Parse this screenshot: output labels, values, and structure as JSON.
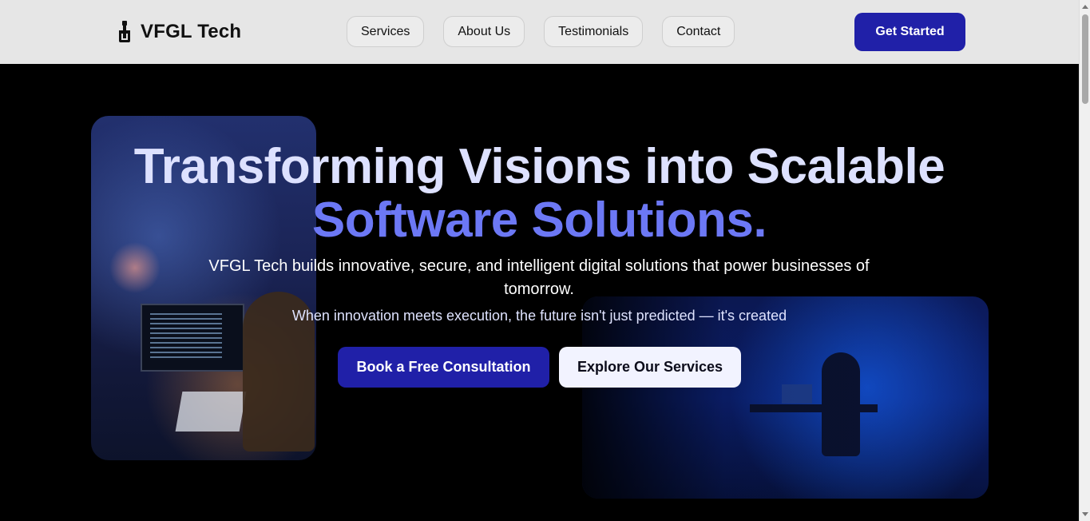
{
  "header": {
    "logo_text": "VFGL Tech",
    "nav": [
      {
        "label": "Services"
      },
      {
        "label": "About Us"
      },
      {
        "label": "Testimonials"
      },
      {
        "label": "Contact"
      }
    ],
    "cta_label": "Get Started"
  },
  "hero": {
    "headline_line1": "Transforming Visions into Scalable",
    "headline_line2": "Software Solutions.",
    "subtitle": "VFGL Tech builds innovative, secure, and intelligent digital solutions that power businesses of tomorrow.",
    "tagline": "When innovation meets execution, the future isn't just predicted — it's created",
    "primary_button": "Book a Free Consultation",
    "secondary_button": "Explore Our Services"
  },
  "colors": {
    "brand_primary": "#2020a8",
    "headline_light": "#dde1ff",
    "headline_accent": "#6c78f5",
    "header_bg": "#e6e6e6"
  },
  "icons": {
    "logo": "ink-bottle-icon"
  }
}
